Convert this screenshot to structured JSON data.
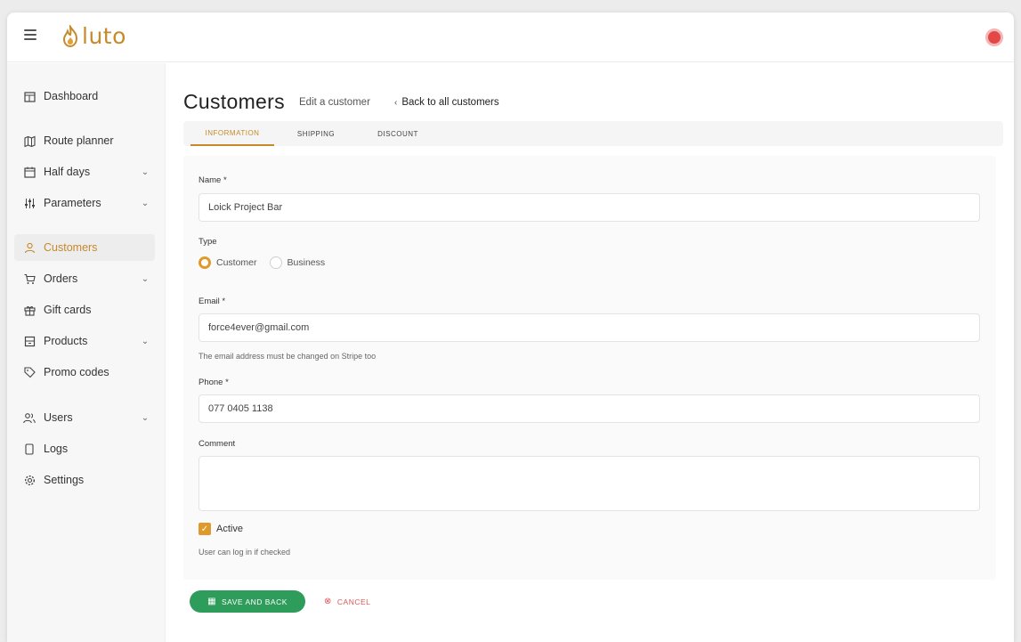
{
  "app": {
    "logo_text": "luto"
  },
  "sidebar": {
    "items": [
      {
        "label": "Dashboard",
        "icon": "calendar-icon"
      },
      {
        "label": "Route planner",
        "icon": "map-icon"
      },
      {
        "label": "Half days",
        "icon": "calendar-icon"
      },
      {
        "label": "Parameters",
        "icon": "sliders-icon"
      },
      {
        "label": "Customers",
        "icon": "user-icon"
      },
      {
        "label": "Orders",
        "icon": "cart-icon"
      },
      {
        "label": "Gift cards",
        "icon": "gift-icon"
      },
      {
        "label": "Products",
        "icon": "box-icon"
      },
      {
        "label": "Promo codes",
        "icon": "tag-icon"
      },
      {
        "label": "Users",
        "icon": "users-icon"
      },
      {
        "label": "Logs",
        "icon": "file-icon"
      },
      {
        "label": "Settings",
        "icon": "gear-icon"
      }
    ]
  },
  "header": {
    "title": "Customers",
    "subtitle": "Edit a customer",
    "back_link": "Back to all customers"
  },
  "tabs": [
    {
      "label": "INFORMATION",
      "active": true
    },
    {
      "label": "SHIPPING",
      "active": false
    },
    {
      "label": "DISCOUNT",
      "active": false
    }
  ],
  "form": {
    "name_label": "Name *",
    "name_value": "Loick Project Bar",
    "type_label": "Type",
    "type_options": [
      "Customer",
      "Business"
    ],
    "type_selected": "Customer",
    "email_label": "Email *",
    "email_value": "force4ever@gmail.com",
    "email_hint": "The email address must be changed on Stripe too",
    "phone_label": "Phone *",
    "phone_value": "077 0405 1138",
    "comment_label": "Comment",
    "comment_value": "",
    "active_label": "Active",
    "active_checked": true,
    "active_hint": "User can log in if checked"
  },
  "actions": {
    "save_label": "SAVE AND BACK",
    "cancel_label": "CANCEL"
  },
  "colors": {
    "accent": "#e09a2b",
    "save": "#2e9c5a",
    "cancel": "#e25555",
    "avatar": "#e24848"
  }
}
